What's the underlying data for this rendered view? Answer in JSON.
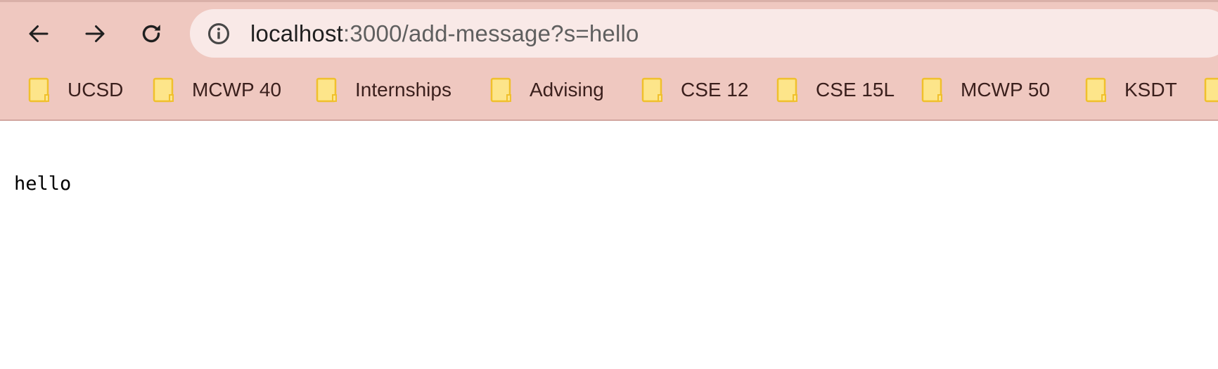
{
  "browser": {
    "nav": {
      "back_icon": "arrow-left-icon",
      "forward_icon": "arrow-right-icon",
      "reload_icon": "reload-icon"
    },
    "address_bar": {
      "icon": "info-icon",
      "url_host": "localhost",
      "url_rest": ":3000/add-message?s=hello"
    },
    "bookmarks": [
      {
        "label": "UCSD",
        "icon": "folder-icon"
      },
      {
        "label": "MCWP 40",
        "icon": "folder-icon"
      },
      {
        "label": "Internships",
        "icon": "folder-icon"
      },
      {
        "label": "Advising",
        "icon": "folder-icon"
      },
      {
        "label": "CSE 12",
        "icon": "folder-icon"
      },
      {
        "label": "CSE 15L",
        "icon": "folder-icon"
      },
      {
        "label": "MCWP 50",
        "icon": "folder-icon"
      },
      {
        "label": "KSDT",
        "icon": "folder-icon"
      },
      {
        "label": "",
        "icon": "folder-icon"
      }
    ],
    "colors": {
      "toolbar": "#efc8c0",
      "omnibox": "#f9e9e7",
      "folder_fill": "#fde58a",
      "folder_stroke": "#f0c02c"
    }
  },
  "page": {
    "body_text": "hello"
  }
}
